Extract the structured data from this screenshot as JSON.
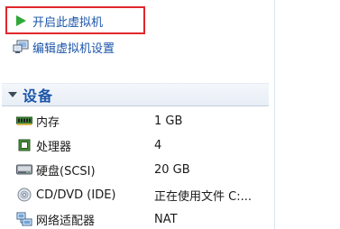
{
  "actions": {
    "power_on_label": "开启此虚拟机",
    "edit_settings_label": "编辑虚拟机设置"
  },
  "devices_section": {
    "title": "设备"
  },
  "devices": [
    {
      "name": "内存",
      "value": "1 GB",
      "icon": "memory-icon"
    },
    {
      "name": "处理器",
      "value": "4",
      "icon": "processor-icon"
    },
    {
      "name": "硬盘(SCSI)",
      "value": "20 GB",
      "icon": "hard-disk-icon"
    },
    {
      "name": "CD/DVD (IDE)",
      "value": "正在使用文件 C:...",
      "icon": "cd-dvd-icon"
    },
    {
      "name": "网络适配器",
      "value": "NAT",
      "icon": "network-adapter-icon"
    }
  ],
  "colors": {
    "link": "#1b55a8",
    "highlight_border": "#e0272b",
    "play_green": "#2ea836"
  }
}
